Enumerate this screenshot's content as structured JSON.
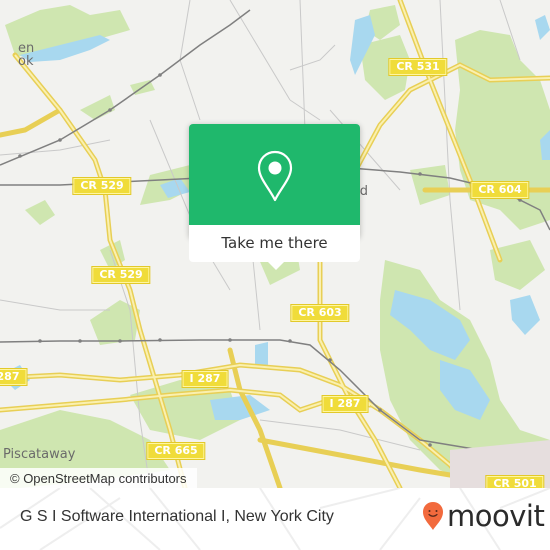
{
  "map": {
    "place_labels": [
      {
        "id": "bound-brook",
        "text": "en\nok"
      },
      {
        "id": "south-plainfield",
        "text": "th\nfield"
      },
      {
        "id": "piscataway",
        "text": "Piscataway"
      }
    ],
    "road_labels": [
      {
        "id": "cr-531",
        "text": "CR 531"
      },
      {
        "id": "cr-529-top",
        "text": "CR 529"
      },
      {
        "id": "cr-529-mid",
        "text": "CR 529"
      },
      {
        "id": "cr-604",
        "text": "CR 604"
      },
      {
        "id": "cr-603",
        "text": "CR 603"
      },
      {
        "id": "i-287-left",
        "text": "287"
      },
      {
        "id": "i-287-mid",
        "text": "I 287"
      },
      {
        "id": "i-287-right",
        "text": "I 287"
      },
      {
        "id": "cr-665",
        "text": "CR 665"
      },
      {
        "id": "cr-501",
        "text": "CR 501"
      }
    ],
    "attribution": "© OpenStreetMap contributors",
    "colors": {
      "land": "#f2f2ef",
      "park": "#cfe6b0",
      "water": "#a8d8ef",
      "road_major": "#f6e27a",
      "rail": "#777777"
    }
  },
  "popup": {
    "icon": "location-pin-icon",
    "button_label": "Take me there",
    "accent": "#1fb86c"
  },
  "footer": {
    "title": "G S I Software International I, New York City",
    "brand": "moovit",
    "brand_color": "#f26a3d"
  }
}
